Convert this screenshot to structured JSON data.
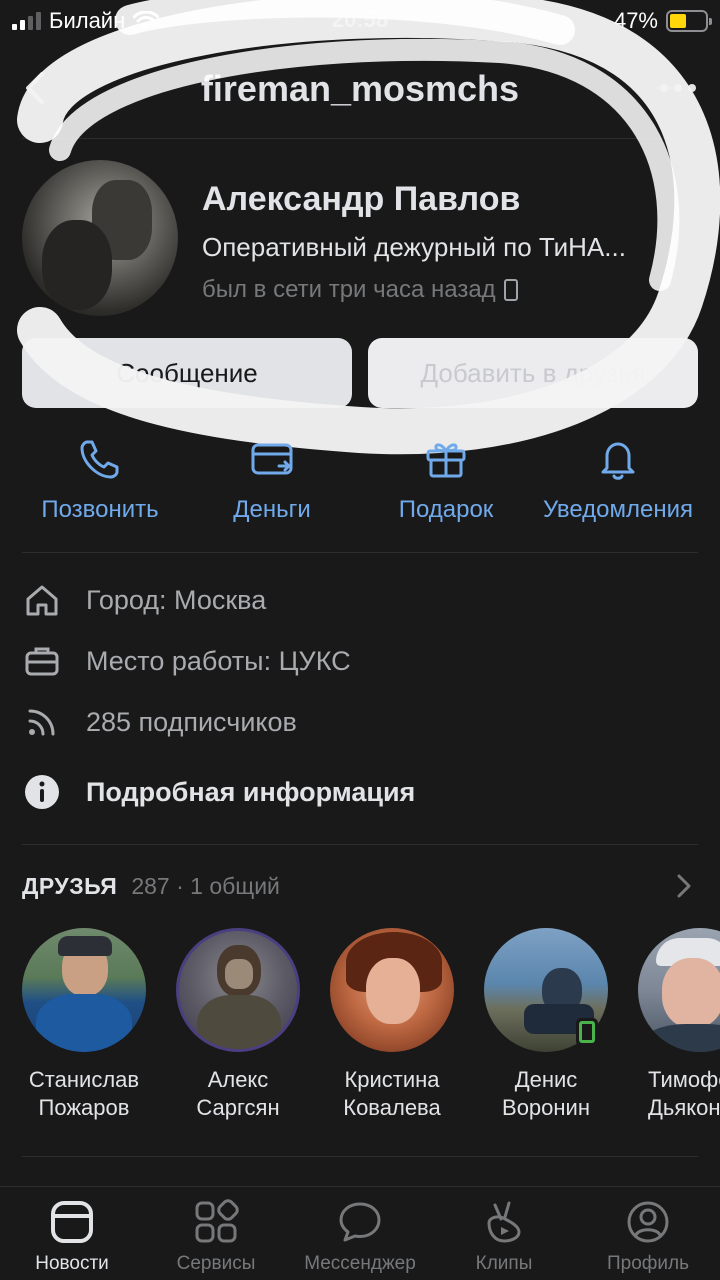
{
  "status_bar": {
    "carrier": "Билайн",
    "time": "20:58",
    "battery_percent": "47%",
    "battery_level": 0.47
  },
  "nav": {
    "title": "fireman_mosmchs"
  },
  "profile": {
    "name": "Александр Павлов",
    "status": "Оперативный дежурный по ТиНА...",
    "last_seen": "был в сети три часа назад"
  },
  "buttons": {
    "message": "Сообщение",
    "add_friend": "Добавить в друзья"
  },
  "actions": [
    {
      "label": "Позвонить",
      "icon": "phone-icon"
    },
    {
      "label": "Деньги",
      "icon": "money-transfer-icon"
    },
    {
      "label": "Подарок",
      "icon": "gift-icon"
    },
    {
      "label": "Уведомления",
      "icon": "bell-icon"
    }
  ],
  "info": {
    "city": "Город: Москва",
    "work": "Место работы: ЦУКС",
    "followers": "285 подписчиков",
    "details": "Подробная информация"
  },
  "friends": {
    "header": "ДРУЗЬЯ",
    "count": "287 · 1 общий",
    "items": [
      {
        "first": "Станислав",
        "last": "Пожаров"
      },
      {
        "first": "Алекс",
        "last": "Саргсян"
      },
      {
        "first": "Кристина",
        "last": "Ковалева"
      },
      {
        "first": "Денис",
        "last": "Воронин"
      },
      {
        "first": "Тимофей",
        "last": "Дьяконов"
      }
    ]
  },
  "tabbar": {
    "items": [
      {
        "label": "Новости",
        "icon": "news-icon"
      },
      {
        "label": "Сервисы",
        "icon": "services-icon"
      },
      {
        "label": "Мессенджер",
        "icon": "messenger-icon"
      },
      {
        "label": "Клипы",
        "icon": "clips-icon"
      },
      {
        "label": "Профиль",
        "icon": "profile-icon"
      }
    ],
    "active": "Новости"
  },
  "colors": {
    "background": "#19191a",
    "accent": "#71aaeb",
    "text": "#e1e3e6",
    "secondary_text": "#76787a",
    "online_green": "#4bb34b",
    "battery_yellow": "#ffd60a"
  }
}
